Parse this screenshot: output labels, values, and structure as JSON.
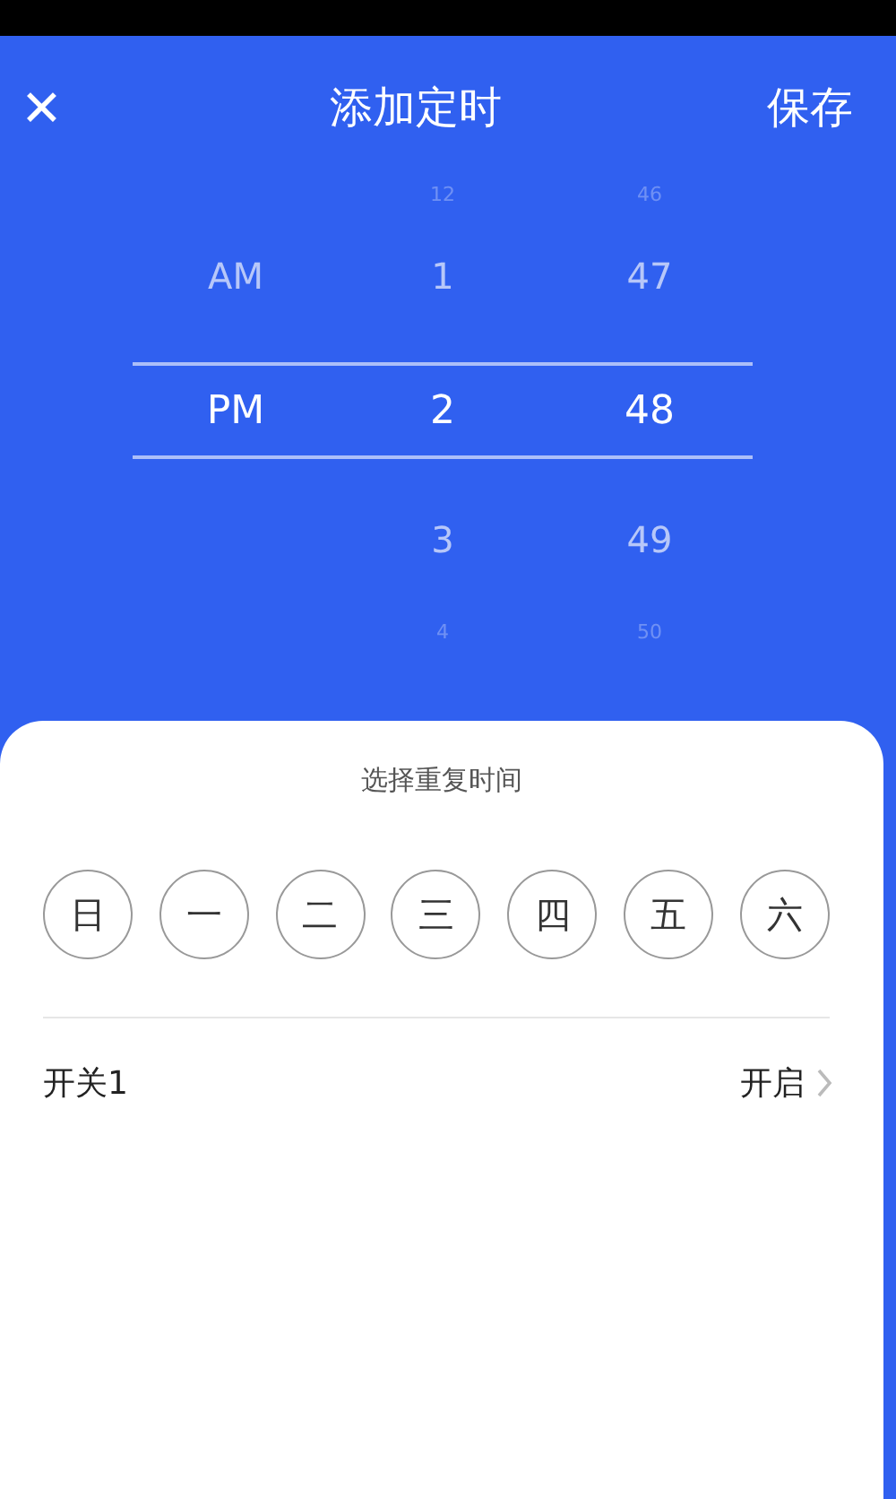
{
  "header": {
    "close_icon": "✕",
    "title": "添加定时",
    "save": "保存"
  },
  "picker": {
    "columns": [
      {
        "items": [
          {
            "text": "AM",
            "selected": false
          },
          {
            "text": "PM",
            "selected": true
          }
        ]
      },
      {
        "items": [
          {
            "text": "12",
            "selected": false
          },
          {
            "text": "1",
            "selected": false
          },
          {
            "text": "2",
            "selected": true
          },
          {
            "text": "3",
            "selected": false
          },
          {
            "text": "4",
            "selected": false
          }
        ]
      },
      {
        "items": [
          {
            "text": "46",
            "selected": false
          },
          {
            "text": "47",
            "selected": false
          },
          {
            "text": "48",
            "selected": true
          },
          {
            "text": "49",
            "selected": false
          },
          {
            "text": "50",
            "selected": false
          }
        ]
      }
    ]
  },
  "repeat": {
    "title": "选择重复时间",
    "days": [
      {
        "label": "日",
        "selected": false
      },
      {
        "label": "一",
        "selected": false
      },
      {
        "label": "二",
        "selected": false
      },
      {
        "label": "三",
        "selected": false
      },
      {
        "label": "四",
        "selected": false
      },
      {
        "label": "五",
        "selected": false
      },
      {
        "label": "六",
        "selected": false
      }
    ]
  },
  "switch_row": {
    "label": "开关1",
    "value": "开启"
  }
}
